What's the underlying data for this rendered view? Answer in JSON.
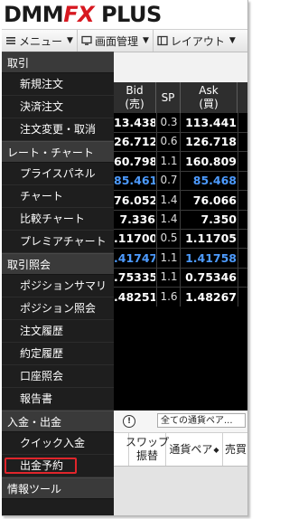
{
  "app": {
    "logo_main": "DMM",
    "logo_fx": "FX",
    "logo_plus": "PLUS"
  },
  "menubar": {
    "menu": "メニュー",
    "screen": "画面管理",
    "layout": "レイアウト"
  },
  "sidebar": {
    "sections": [
      {
        "title": "取引",
        "items": [
          "新規注文",
          "決済注文",
          "注文変更・取消"
        ]
      },
      {
        "title": "レート・チャート",
        "items": [
          "プライスパネル",
          "チャート",
          "比較チャート",
          "プレミアチャート"
        ]
      },
      {
        "title": "取引照会",
        "items": [
          "ポジションサマリ",
          "ポジション照会",
          "注文履歴",
          "約定履歴",
          "口座照会",
          "報告書"
        ]
      },
      {
        "title": "入金・出金",
        "items": [
          "クイック入金",
          "出金予約"
        ]
      },
      {
        "title": "情報ツール",
        "items": []
      }
    ],
    "highlighted_item": "出金予約"
  },
  "rate_table": {
    "headers": {
      "bid_1": "Bid",
      "bid_2": "(売)",
      "sp": "SP",
      "ask_1": "Ask",
      "ask_2": "(買)"
    },
    "rows": [
      {
        "bid": "13.438",
        "sp": "0.3",
        "ask": "113.441",
        "blue": false
      },
      {
        "bid": "26.712",
        "sp": "0.6",
        "ask": "126.718",
        "blue": false
      },
      {
        "bid": "60.798",
        "sp": "1.1",
        "ask": "160.809",
        "blue": false
      },
      {
        "bid": "85.461",
        "sp": "0.7",
        "ask": "85.468",
        "blue": true
      },
      {
        "bid": "76.052",
        "sp": "1.4",
        "ask": "76.066",
        "blue": false
      },
      {
        "bid": "7.336",
        "sp": "1.4",
        "ask": "7.350",
        "blue": false
      },
      {
        "bid": ".11700",
        "sp": "0.5",
        "ask": "1.11705",
        "blue": false
      },
      {
        "bid": ".41747",
        "sp": "1.1",
        "ask": "1.41758",
        "blue": true
      },
      {
        "bid": ".75335",
        "sp": "1.1",
        "ask": "0.75346",
        "blue": false
      },
      {
        "bid": ".48251",
        "sp": "1.6",
        "ask": "1.48267",
        "blue": false
      }
    ]
  },
  "bottom_panel": {
    "info_icon": "!",
    "currency_select": "全ての通貨ペア...",
    "headers": {
      "swap_1": "スワップ",
      "swap_2": "振替",
      "pair": "通貨ペア",
      "sell": "売買"
    }
  },
  "colors": {
    "highlight": "#e0252b",
    "blue_rate": "#4d9bff"
  }
}
